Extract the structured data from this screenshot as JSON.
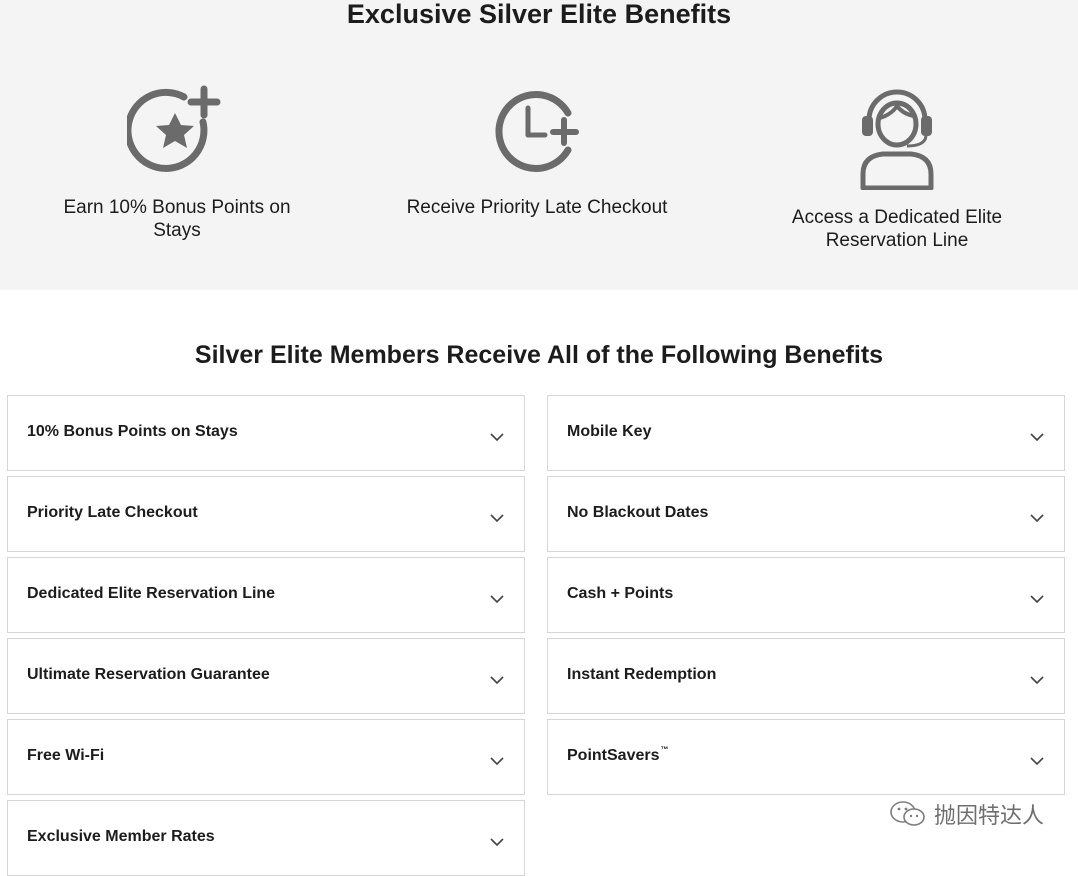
{
  "header": {
    "title": "Exclusive Silver Elite Benefits"
  },
  "highlights": [
    {
      "icon": "star-plus-icon",
      "label": "Earn 10% Bonus Points on Stays"
    },
    {
      "icon": "clock-plus-icon",
      "label": "Receive Priority Late Checkout"
    },
    {
      "icon": "headset-agent-icon",
      "label": "Access a Dedicated Elite Reservation Line"
    }
  ],
  "section": {
    "title": "Silver Elite Members Receive All of the Following Benefits"
  },
  "accordion": {
    "left": [
      {
        "label": "10% Bonus Points on Stays"
      },
      {
        "label": "Priority Late Checkout"
      },
      {
        "label": "Dedicated Elite Reservation Line"
      },
      {
        "label": "Ultimate Reservation Guarantee"
      },
      {
        "label": "Free Wi-Fi"
      },
      {
        "label": "Exclusive Member Rates"
      }
    ],
    "right": [
      {
        "label": "Mobile Key"
      },
      {
        "label": "No Blackout Dates"
      },
      {
        "label": "Cash + Points"
      },
      {
        "label": "Instant Redemption"
      },
      {
        "label": "PointSavers",
        "mark": "™"
      }
    ]
  },
  "watermark": {
    "text": "抛因特达人"
  },
  "colors": {
    "band": "#f4f4f4",
    "icon": "#6b6b6b",
    "text": "#1c1c1c",
    "border": "#d6d6d6"
  }
}
